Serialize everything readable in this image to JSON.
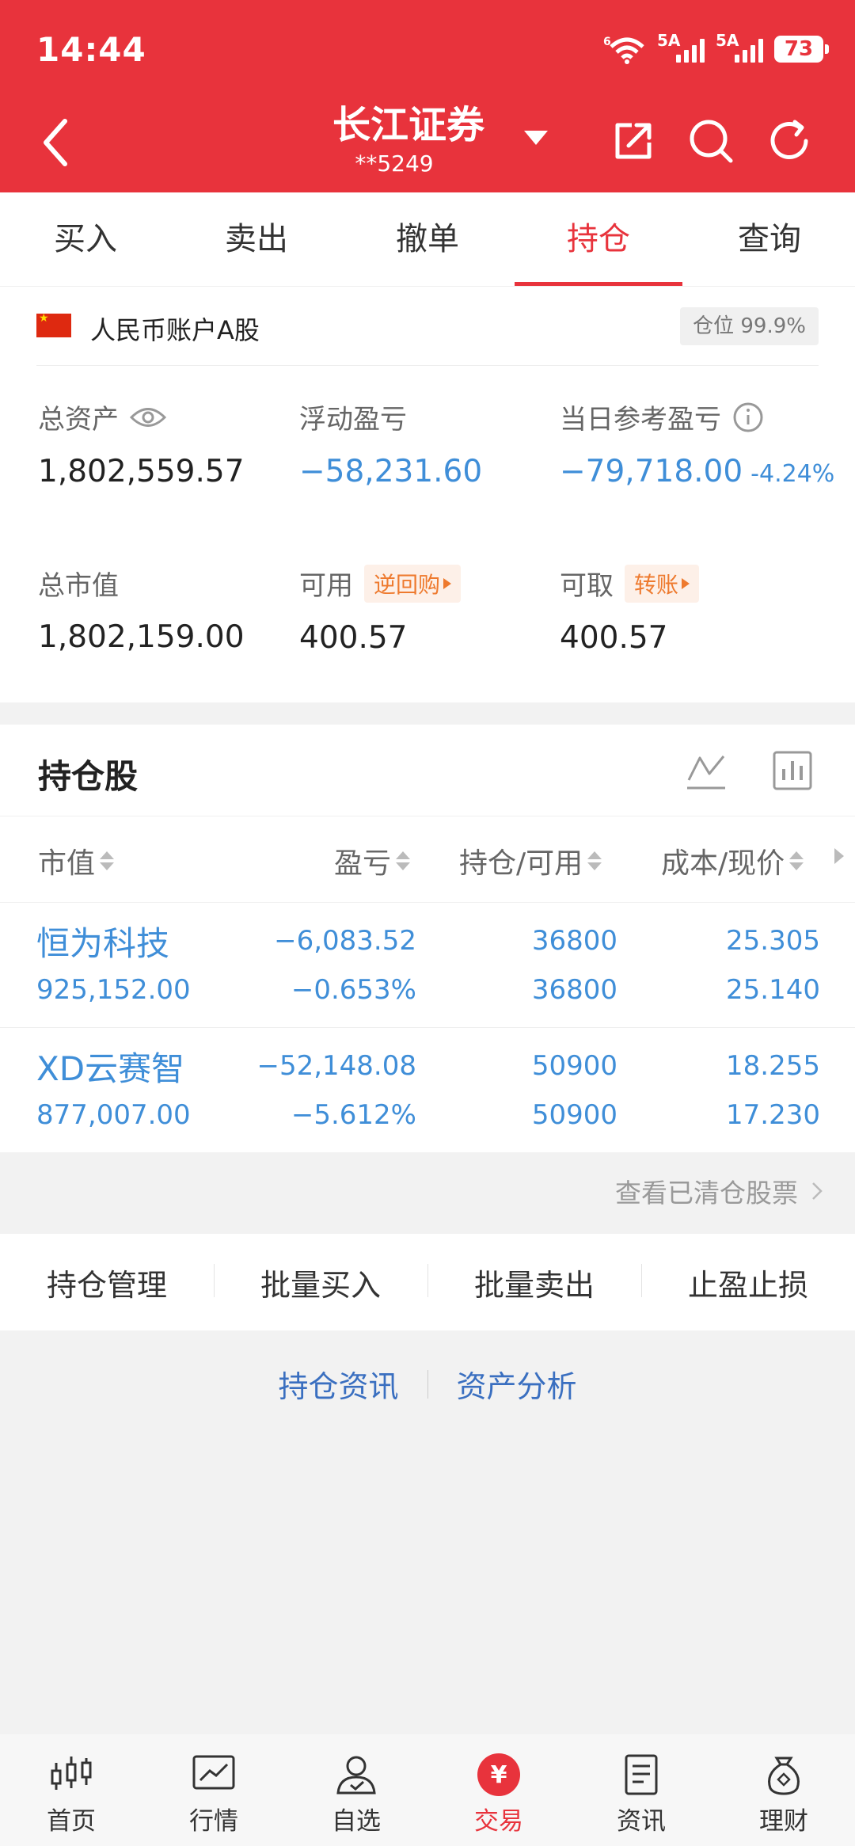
{
  "status_bar": {
    "time": "14:44",
    "signal1_label": "5A",
    "signal2_label": "5A",
    "battery": "73",
    "wifi_label": "6"
  },
  "header": {
    "title": "长江证券",
    "account": "**5249"
  },
  "tabs": [
    {
      "label": "买入"
    },
    {
      "label": "卖出"
    },
    {
      "label": "撤单"
    },
    {
      "label": "持仓",
      "active": true
    },
    {
      "label": "查询"
    }
  ],
  "account_card": {
    "label": "人民币账户A股",
    "position_badge": "仓位 99.9%",
    "total_assets_label": "总资产",
    "total_assets": "1,802,559.57",
    "floating_pl_label": "浮动盈亏",
    "floating_pl": "−58,231.60",
    "daily_pl_label": "当日参考盈亏",
    "daily_pl": "−79,718.00",
    "daily_pl_pct": "-4.24%",
    "market_value_label": "总市值",
    "market_value": "1,802,159.00",
    "available_label": "可用",
    "available": "400.57",
    "reverse_repo_label": "逆回购",
    "withdrawable_label": "可取",
    "withdrawable": "400.57",
    "transfer_label": "转账"
  },
  "holdings": {
    "title": "持仓股",
    "columns": [
      "市值",
      "盈亏",
      "持仓/可用",
      "成本/现价"
    ],
    "rows": [
      {
        "name": "恒为科技",
        "market_value": "925,152.00",
        "pl": "−6,083.52",
        "pl_pct": "−0.653%",
        "position": "36800",
        "available": "36800",
        "cost": "25.305",
        "price": "25.140"
      },
      {
        "name": "XD云赛智",
        "market_value": "877,007.00",
        "pl": "−52,148.08",
        "pl_pct": "−5.612%",
        "position": "50900",
        "available": "50900",
        "cost": "18.255",
        "price": "17.230"
      }
    ]
  },
  "cleared_link": "查看已清仓股票",
  "actions": [
    "持仓管理",
    "批量买入",
    "批量卖出",
    "止盈止损"
  ],
  "links": [
    "持仓资讯",
    "资产分析"
  ],
  "nav": [
    {
      "label": "首页",
      "icon": "candlestick-icon"
    },
    {
      "label": "行情",
      "icon": "chart-icon"
    },
    {
      "label": "自选",
      "icon": "user-check-icon"
    },
    {
      "label": "交易",
      "icon": "yuan-icon",
      "glyph": "¥",
      "active": true
    },
    {
      "label": "资讯",
      "icon": "news-icon"
    },
    {
      "label": "理财",
      "icon": "money-bag-icon"
    }
  ],
  "colors": {
    "brand_red": "#e8333c",
    "loss_blue": "#3f8ed8",
    "tag_orange": "#ee7a2e"
  }
}
